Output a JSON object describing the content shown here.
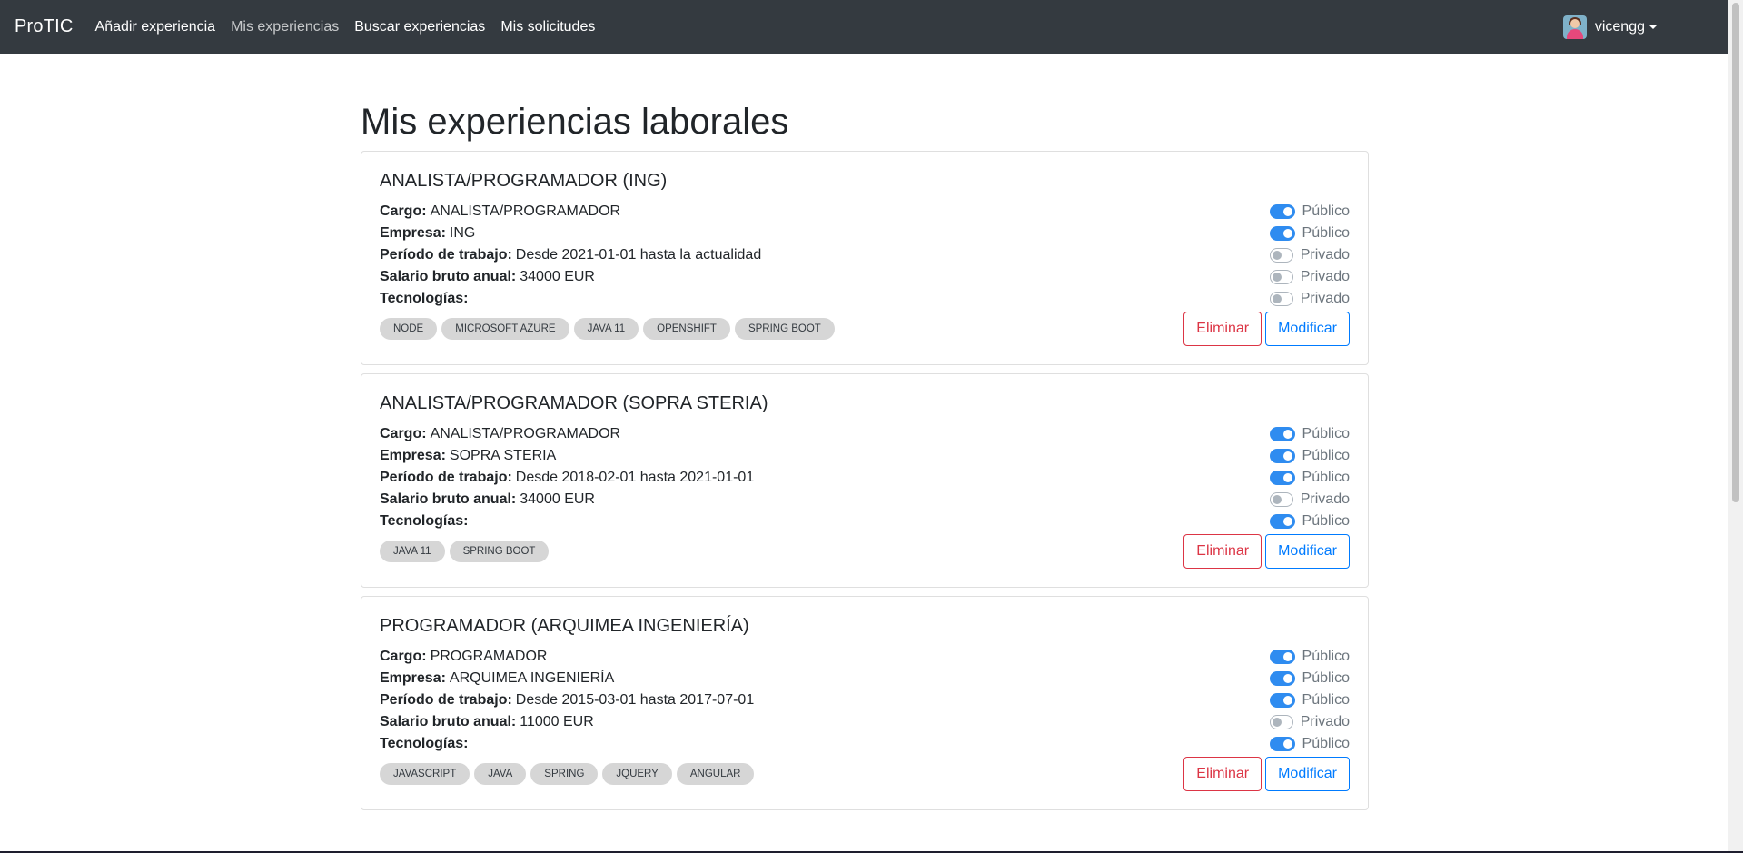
{
  "navbar": {
    "brand": "ProTIC",
    "links": [
      {
        "label": "Añadir experiencia"
      },
      {
        "label": "Mis experiencias"
      },
      {
        "label": "Buscar experiencias"
      },
      {
        "label": "Mis solicitudes"
      }
    ],
    "user": "vicengg"
  },
  "page_title": "Mis experiencias laborales",
  "labels": {
    "cargo": "Cargo:",
    "empresa": "Empresa:",
    "periodo": "Período de trabajo:",
    "salario": "Salario bruto anual:",
    "tecnologias": "Tecnologías:"
  },
  "buttons": {
    "delete": "Eliminar",
    "edit": "Modificar"
  },
  "experiences": [
    {
      "title": "ANALISTA/PROGRAMADOR (ING)",
      "cargo": "ANALISTA/PROGRAMADOR",
      "empresa": "ING",
      "periodo": "Desde 2021-01-01 hasta la actualidad",
      "salario": "34000 EUR",
      "visibility": [
        {
          "on": true,
          "label": "Público"
        },
        {
          "on": true,
          "label": "Público"
        },
        {
          "on": false,
          "label": "Privado"
        },
        {
          "on": false,
          "label": "Privado"
        },
        {
          "on": false,
          "label": "Privado"
        }
      ],
      "tags": [
        "NODE",
        "MICROSOFT AZURE",
        "JAVA 11",
        "OPENSHIFT",
        "SPRING BOOT"
      ]
    },
    {
      "title": "ANALISTA/PROGRAMADOR (SOPRA STERIA)",
      "cargo": "ANALISTA/PROGRAMADOR",
      "empresa": "SOPRA STERIA",
      "periodo": "Desde 2018-02-01 hasta 2021-01-01",
      "salario": "34000 EUR",
      "visibility": [
        {
          "on": true,
          "label": "Público"
        },
        {
          "on": true,
          "label": "Público"
        },
        {
          "on": true,
          "label": "Público"
        },
        {
          "on": false,
          "label": "Privado"
        },
        {
          "on": true,
          "label": "Público"
        }
      ],
      "tags": [
        "JAVA 11",
        "SPRING BOOT"
      ]
    },
    {
      "title": "PROGRAMADOR (ARQUIMEA INGENIERÍA)",
      "cargo": "PROGRAMADOR",
      "empresa": "ARQUIMEA INGENIERÍA",
      "periodo": "Desde 2015-03-01 hasta 2017-07-01",
      "salario": "11000 EUR",
      "visibility": [
        {
          "on": true,
          "label": "Público"
        },
        {
          "on": true,
          "label": "Público"
        },
        {
          "on": true,
          "label": "Público"
        },
        {
          "on": false,
          "label": "Privado"
        },
        {
          "on": true,
          "label": "Público"
        }
      ],
      "tags": [
        "JAVASCRIPT",
        "JAVA",
        "SPRING",
        "JQUERY",
        "ANGULAR"
      ]
    }
  ]
}
